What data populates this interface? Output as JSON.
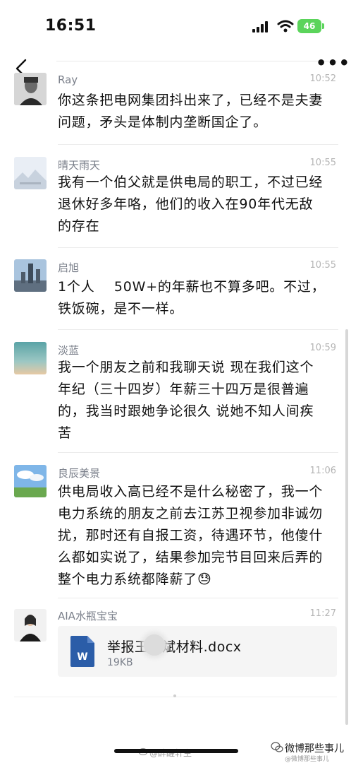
{
  "status_bar": {
    "time": "16:51",
    "battery": "46"
  },
  "comments": [
    {
      "name": "Ray",
      "time": "10:52",
      "lines": [
        "你这条把电网集团抖出来了，已经不是夫妻",
        "问题，矛头是体制内垄断国企了。"
      ]
    },
    {
      "name": "晴天雨天",
      "time": "10:55",
      "lines": [
        "我有一个伯父就是供电局的职工，不过已经",
        "退休好多年咯，他们的收入在90年代无敌",
        "的存在"
      ]
    },
    {
      "name": "启旭",
      "time": "10:55",
      "lines": [
        "1个人    50W+的年薪也不算多吧。不过，",
        "铁饭碗，是不一样。"
      ]
    },
    {
      "name": "淡蓝",
      "time": "10:59",
      "lines": [
        "我一个朋友之前和我聊天说 现在我们这个",
        "年纪（三十四岁）年薪三十四万是很普遍",
        "的，我当时跟她争论很久 说她不知人间疾",
        "苦"
      ]
    },
    {
      "name": "良辰美景",
      "time": "11:06",
      "lines": [
        "供电局收入高已经不是什么秘密了，我一个",
        "电力系统的朋友之前去江苏卫视参加非诚勿",
        "扰，那时还有自报工资，待遇环节，他傻什",
        "么都如实说了，结果参加完节目回来后弄的",
        "整个电力系统都降薪了😓"
      ]
    },
    {
      "name": "AIA水瓶宝宝",
      "time": "11:27"
    }
  ],
  "file": {
    "name": "举报王   斌材料.docx",
    "size": "19KB",
    "icon_letter": "W"
  },
  "watermarks": {
    "left": "@醉醒轩主",
    "right": "微博那些事儿",
    "right_sub": "@微博那些事儿"
  }
}
